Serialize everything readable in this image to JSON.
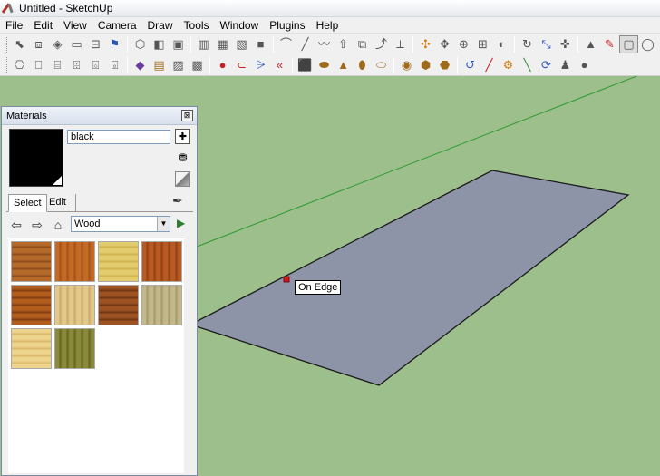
{
  "window": {
    "title": "Untitled - SketchUp"
  },
  "menubar": {
    "items": [
      "File",
      "Edit",
      "View",
      "Camera",
      "Draw",
      "Tools",
      "Window",
      "Plugins",
      "Help"
    ]
  },
  "toolbar1": {
    "groups": [
      [
        {
          "icon": "select-arrow-icon",
          "glyph": "⬉"
        },
        {
          "icon": "make-component-icon",
          "glyph": "⧈"
        },
        {
          "icon": "paint-bucket-icon",
          "glyph": "◈"
        },
        {
          "icon": "eraser-icon",
          "glyph": "▭"
        },
        {
          "icon": "tape-measure-icon",
          "glyph": "⊟"
        },
        {
          "icon": "walk-icon",
          "glyph": "⚑"
        }
      ],
      [
        {
          "icon": "iso-view-icon",
          "glyph": "⬡"
        },
        {
          "icon": "top-view-icon",
          "glyph": "◧"
        },
        {
          "icon": "front-view-icon",
          "glyph": "▣"
        }
      ],
      [
        {
          "icon": "xray-icon",
          "glyph": "▥"
        },
        {
          "icon": "wireframe-icon",
          "glyph": "▦"
        },
        {
          "icon": "hidden-line-icon",
          "glyph": "▧"
        },
        {
          "icon": "shaded-icon",
          "glyph": "■"
        }
      ],
      [
        {
          "icon": "arc-icon",
          "glyph": "⌒"
        },
        {
          "icon": "line-icon",
          "glyph": "╱"
        },
        {
          "icon": "freehand-icon",
          "glyph": "〰"
        },
        {
          "icon": "push-pull-icon",
          "glyph": "⇧"
        },
        {
          "icon": "offset-icon",
          "glyph": "⧉"
        },
        {
          "icon": "follow-me-icon",
          "glyph": "⤴"
        },
        {
          "icon": "tape-icon",
          "glyph": "⟂"
        }
      ],
      [
        {
          "icon": "orbit-icon",
          "glyph": "✣"
        },
        {
          "icon": "pan-icon",
          "glyph": "✥"
        },
        {
          "icon": "zoom-icon",
          "glyph": "⊕"
        },
        {
          "icon": "zoom-window-icon",
          "glyph": "⊞"
        },
        {
          "icon": "previous-view-icon",
          "glyph": "◐"
        }
      ],
      [
        {
          "icon": "rotate-icon",
          "glyph": "↻"
        },
        {
          "icon": "scale-icon",
          "glyph": "⤡"
        },
        {
          "icon": "move-icon",
          "glyph": "✜"
        }
      ],
      [
        {
          "icon": "select-icon",
          "glyph": "▲",
          "active": false
        },
        {
          "icon": "pencil-icon",
          "glyph": "✎"
        },
        {
          "icon": "rectangle-icon",
          "glyph": "▢",
          "active": true
        },
        {
          "icon": "circle-icon",
          "glyph": "◯"
        }
      ]
    ]
  },
  "toolbar2": {
    "groups": [
      [
        {
          "icon": "component-a-icon",
          "glyph": "⎔"
        },
        {
          "icon": "component-b-icon",
          "glyph": "⎕"
        },
        {
          "icon": "component-c-icon",
          "glyph": "⌸"
        },
        {
          "icon": "component-d-icon",
          "glyph": "⌹"
        },
        {
          "icon": "component-e-icon",
          "glyph": "⌺"
        },
        {
          "icon": "component-f-icon",
          "glyph": "⌻"
        }
      ],
      [
        {
          "icon": "material-icon",
          "glyph": "◆"
        },
        {
          "icon": "sandbox-icon",
          "glyph": "▤"
        },
        {
          "icon": "fog-icon",
          "glyph": "▨"
        },
        {
          "icon": "shadow-icon",
          "glyph": "▩"
        }
      ],
      [
        {
          "icon": "record-icon",
          "glyph": "●"
        },
        {
          "icon": "section-icon",
          "glyph": "⊂"
        },
        {
          "icon": "layer-icon",
          "glyph": "⩥"
        },
        {
          "icon": "back-icon",
          "glyph": "«"
        }
      ],
      [
        {
          "icon": "box-icon",
          "glyph": "⬛"
        },
        {
          "icon": "cylinder-icon",
          "glyph": "⬬"
        },
        {
          "icon": "cone-icon",
          "glyph": "▲"
        },
        {
          "icon": "tube-icon",
          "glyph": "⬮"
        },
        {
          "icon": "pipe-icon",
          "glyph": "⬭"
        }
      ],
      [
        {
          "icon": "torus-icon",
          "glyph": "◉"
        },
        {
          "icon": "solid-a-icon",
          "glyph": "⬢"
        },
        {
          "icon": "solid-b-icon",
          "glyph": "⬣"
        }
      ],
      [
        {
          "icon": "cycle-icon",
          "glyph": "↺"
        },
        {
          "icon": "diag-line-icon",
          "glyph": "╱"
        },
        {
          "icon": "gear-icon",
          "glyph": "⚙"
        },
        {
          "icon": "stick-icon",
          "glyph": "╲"
        },
        {
          "icon": "refresh-icon",
          "glyph": "⟳"
        },
        {
          "icon": "figure-icon",
          "glyph": "♟"
        },
        {
          "icon": "sphere-icon",
          "glyph": "●"
        }
      ]
    ]
  },
  "viewport": {
    "tooltip": "On Edge",
    "ground_color": "#9cbf8c",
    "face_color": "#8e94a8",
    "axis_color": "#2f9a2f"
  },
  "materials": {
    "title": "Materials",
    "close_glyph": "⊠",
    "material_name": "black",
    "tabs": {
      "select": "Select",
      "edit": "Edit"
    },
    "library": "Wood",
    "swatch_color": "#000000",
    "textures": [
      {
        "name": "wood-cherry",
        "c1": "#b56a2a",
        "c2": "#8a4a1a"
      },
      {
        "name": "wood-oak-dark",
        "c1": "#c46a24",
        "c2": "#a0501a"
      },
      {
        "name": "wood-maple",
        "c1": "#e2cc6e",
        "c2": "#cdb24c"
      },
      {
        "name": "wood-mahogany",
        "c1": "#b85a22",
        "c2": "#8e3e14"
      },
      {
        "name": "wood-floor",
        "c1": "#b25c1e",
        "c2": "#7c3a10"
      },
      {
        "name": "wood-light-floor",
        "c1": "#e3c88a",
        "c2": "#c6a66a"
      },
      {
        "name": "wood-walnut",
        "c1": "#9c5222",
        "c2": "#6e3410"
      },
      {
        "name": "wood-bamboo",
        "c1": "#c3b88a",
        "c2": "#a29668"
      },
      {
        "name": "wood-pine",
        "c1": "#eed38c",
        "c2": "#d6b868"
      },
      {
        "name": "wood-olive",
        "c1": "#8a8a3a",
        "c2": "#62621e"
      }
    ]
  }
}
